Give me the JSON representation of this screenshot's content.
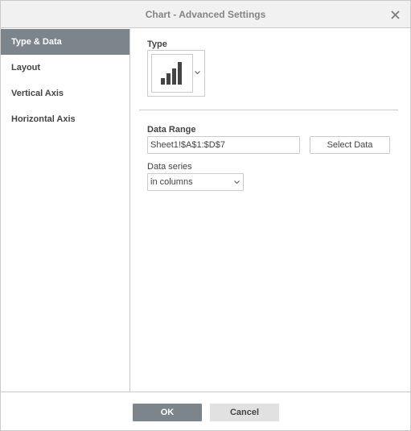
{
  "dialog": {
    "title": "Chart - Advanced Settings",
    "close_icon": "close-icon"
  },
  "sidebar": {
    "items": [
      {
        "label": "Type & Data",
        "active": true
      },
      {
        "label": "Layout",
        "active": false
      },
      {
        "label": "Vertical Axis",
        "active": false
      },
      {
        "label": "Horizontal Axis",
        "active": false
      }
    ]
  },
  "type_section": {
    "label": "Type",
    "selected_icon": "column-chart-icon",
    "caret_icon": "chevron-down-icon"
  },
  "data_range": {
    "label": "Data Range",
    "value": "Sheet1!$A$1:$D$7",
    "select_button": "Select Data"
  },
  "data_series": {
    "label": "Data series",
    "selected": "in columns"
  },
  "footer": {
    "ok_label": "OK",
    "cancel_label": "Cancel"
  },
  "colors": {
    "accent": "#7d858c",
    "border": "#cbcbcb",
    "titlebar": "#f1f1f1",
    "text": "#444444",
    "icon_dark": "#444444"
  }
}
